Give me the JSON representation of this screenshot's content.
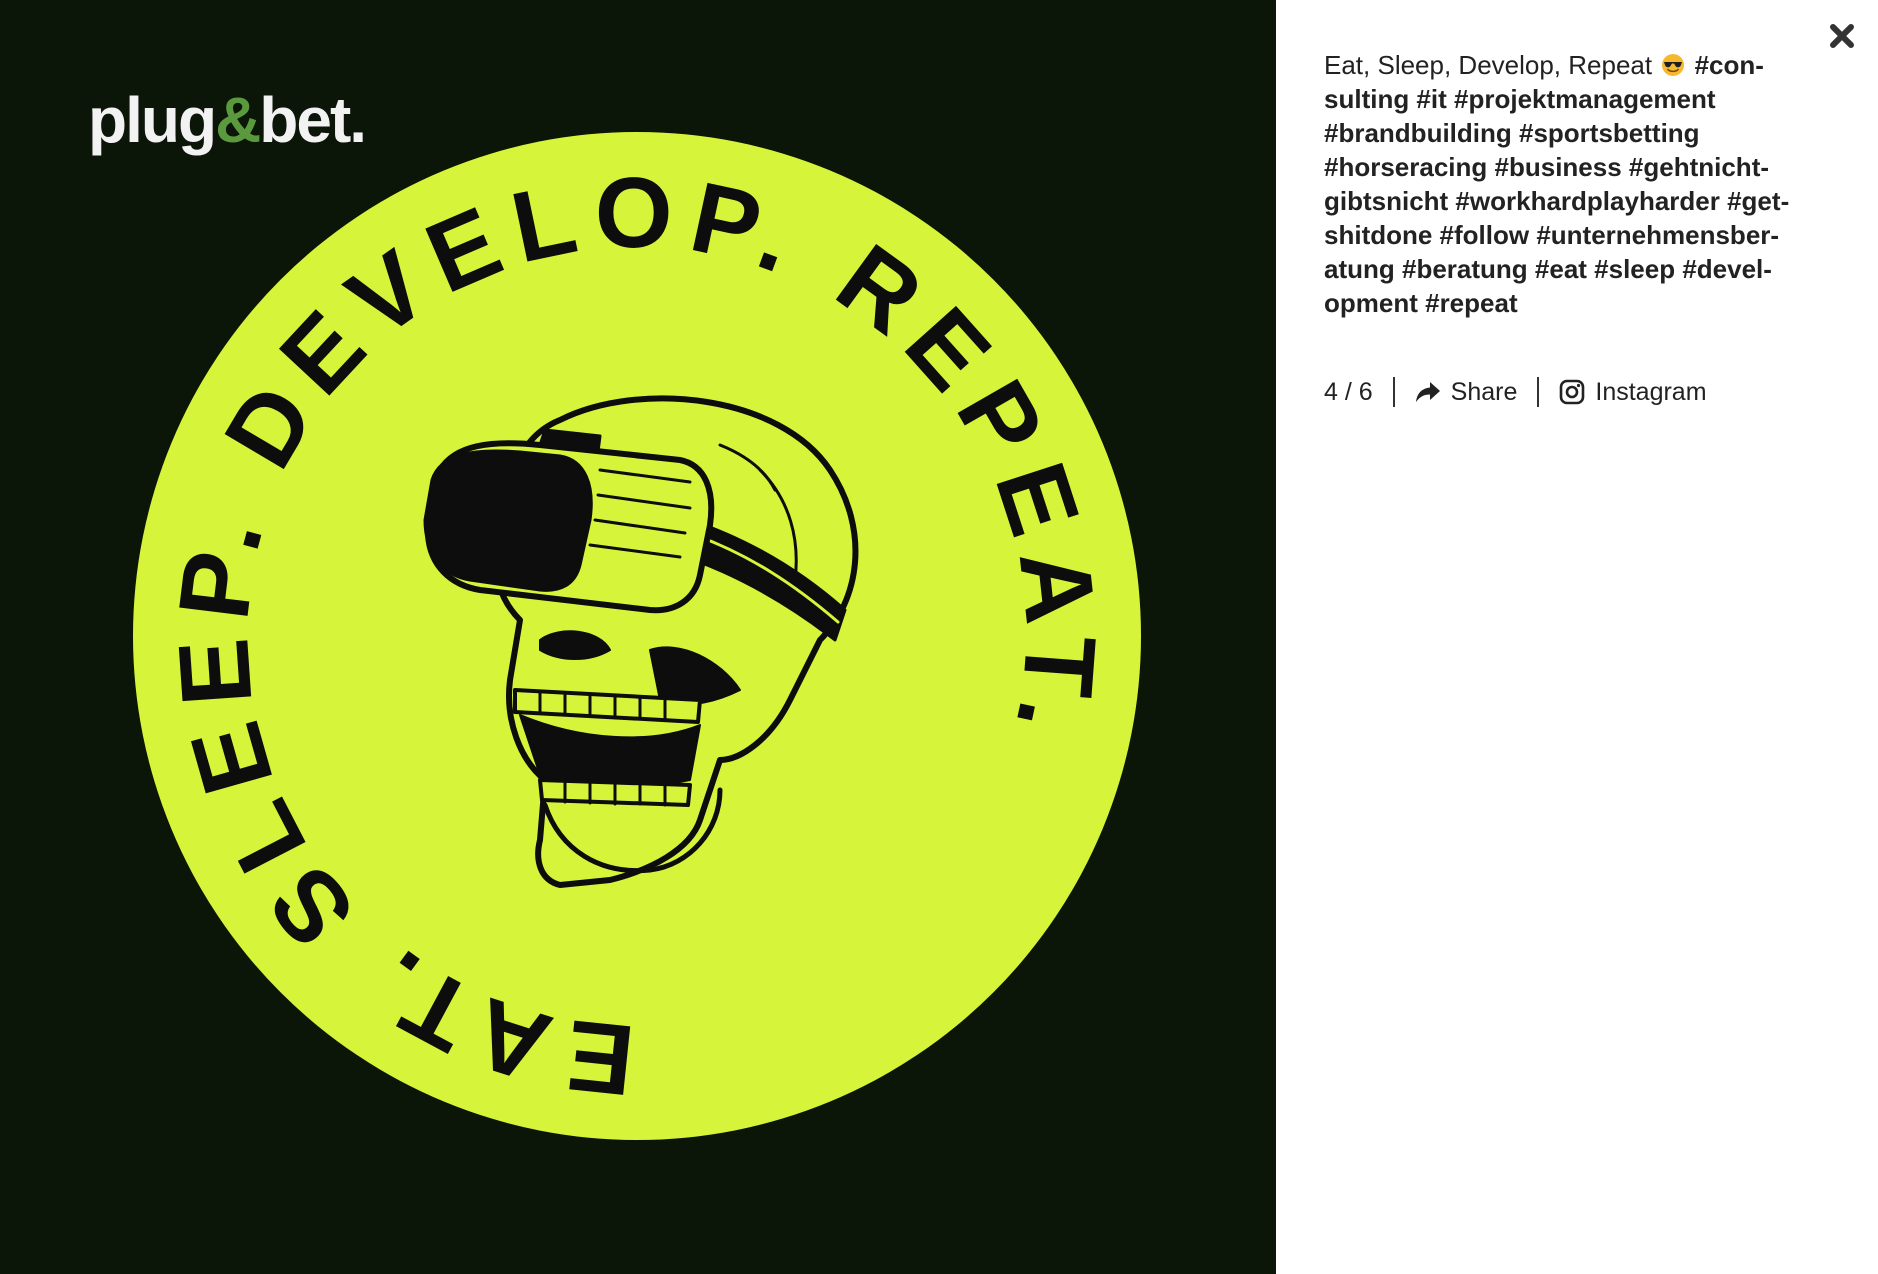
{
  "image": {
    "logo_text_1": "plug",
    "logo_text_amp": "&",
    "logo_text_2": "bet.",
    "ring_text": "EAT. SLEEP. DEVELOP. REPEAT. ",
    "colors": {
      "background": "#0b1508",
      "badge": "#d6f53a",
      "logo_white": "#f2f2f2",
      "logo_green": "#5b9a3c"
    },
    "illustration": "skull-with-vr-headset"
  },
  "caption": {
    "text": "Eat, Sleep, Develop, Repeat",
    "emoji": "smiling-face-with-sunglasses",
    "hashtags": "#con­sulting #it #projektmanagement #brandbuilding #sportsbetting #horseracing #business #gehtnicht­gibtsnicht #workhardplayharder #get­shitdone #follow #unternehmensber­atung #beratung #eat #sleep #devel­opment #repeat"
  },
  "meta": {
    "counter": "4 / 6",
    "share_label": "Share",
    "instagram_label": "Instagram"
  },
  "icons": {
    "close": "close-icon",
    "share": "share-icon",
    "instagram": "instagram-icon"
  }
}
